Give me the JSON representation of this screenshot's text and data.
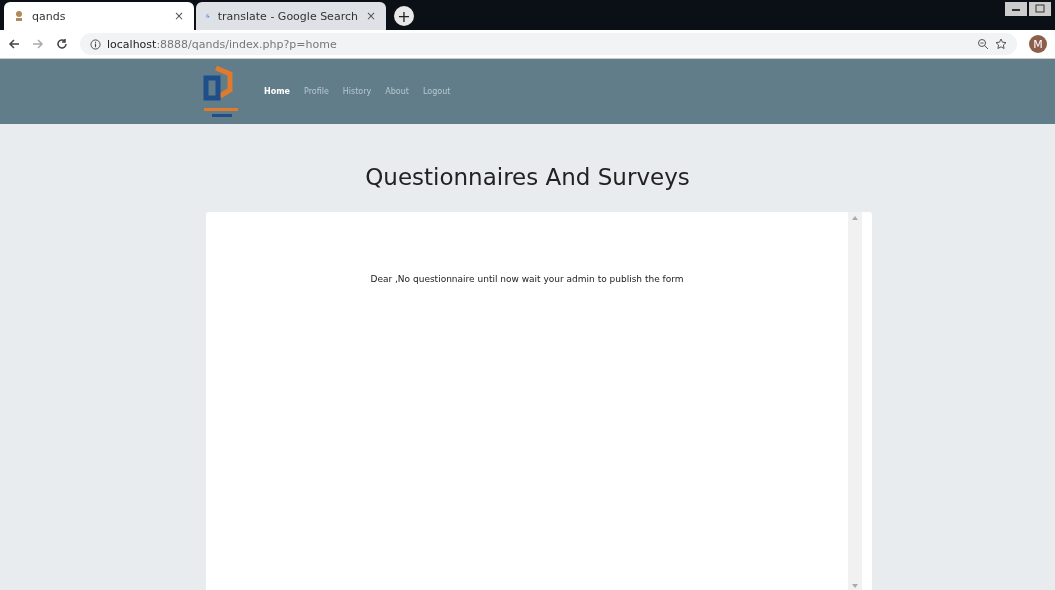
{
  "browser": {
    "tabs": [
      {
        "title": "qands",
        "close": "×",
        "selected": true
      },
      {
        "title": "translate - Google Search",
        "close": "×",
        "selected": false
      }
    ],
    "new_tab": "+",
    "url_host": "localhost",
    "url_rest": ":8888/qands/index.php?p=home",
    "avatar": "M"
  },
  "nav": {
    "items": [
      {
        "label": "Home",
        "selected": true
      },
      {
        "label": "Profile",
        "selected": false
      },
      {
        "label": "History",
        "selected": false
      },
      {
        "label": "About",
        "selected": false
      },
      {
        "label": "Logout",
        "selected": false
      }
    ]
  },
  "heading": "Questionnaires And Surveys",
  "message": "Dear ,No questionnaire until now wait your admin to publish the form"
}
